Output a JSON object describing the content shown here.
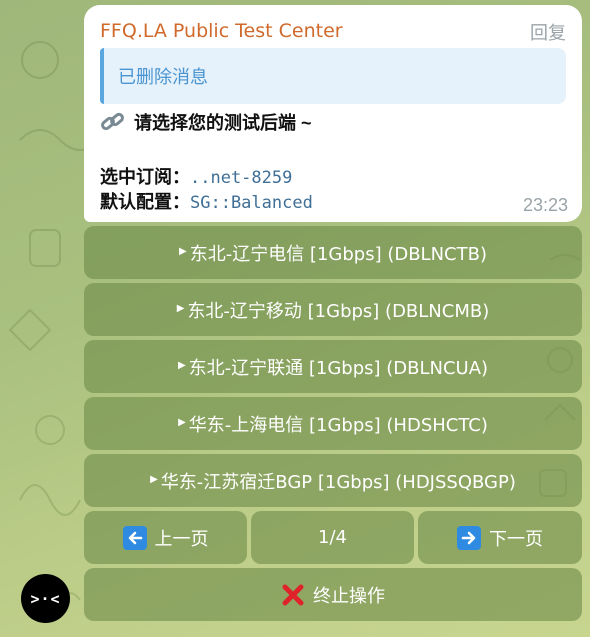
{
  "avatar": {
    "text": ">·<"
  },
  "message": {
    "sender": "FFQ.LA Public Test Center",
    "reply_label": "回复",
    "quoted_text": "已删除消息",
    "prompt": "请选择您的测试后端 ~",
    "subscription_label": "选中订阅：",
    "subscription_value": "..net-8259",
    "config_label": "默认配置：",
    "config_value": "SG::Balanced",
    "time": "23:23"
  },
  "keyboard": {
    "options": [
      {
        "label": "东北-辽宁电信 [1Gbps] (DBLNCTB)"
      },
      {
        "label": "东北-辽宁移动 [1Gbps] (DBLNCMB)"
      },
      {
        "label": "东北-辽宁联通 [1Gbps] (DBLNCUA)"
      },
      {
        "label": "华东-上海电信 [1Gbps] (HDSHCTC)"
      },
      {
        "label": "华东-江苏宿迁BGP [1Gbps] (HDJSSQBGP)"
      }
    ],
    "prev_label": "上一页",
    "page_indicator": "1/4",
    "next_label": "下一页",
    "abort_label": "终止操作"
  },
  "colors": {
    "sender": "#d06a2c",
    "quote_accent": "#5aa6df",
    "button_bg": "#708c4a",
    "arrow_blue": "#2f8be2",
    "abort_red": "#e0232b"
  },
  "icons": {
    "prompt": "link-icon",
    "prev": "left-arrow-icon",
    "next": "right-arrow-icon",
    "abort": "cross-mark-icon",
    "option_marker": "triangle-right-icon"
  }
}
